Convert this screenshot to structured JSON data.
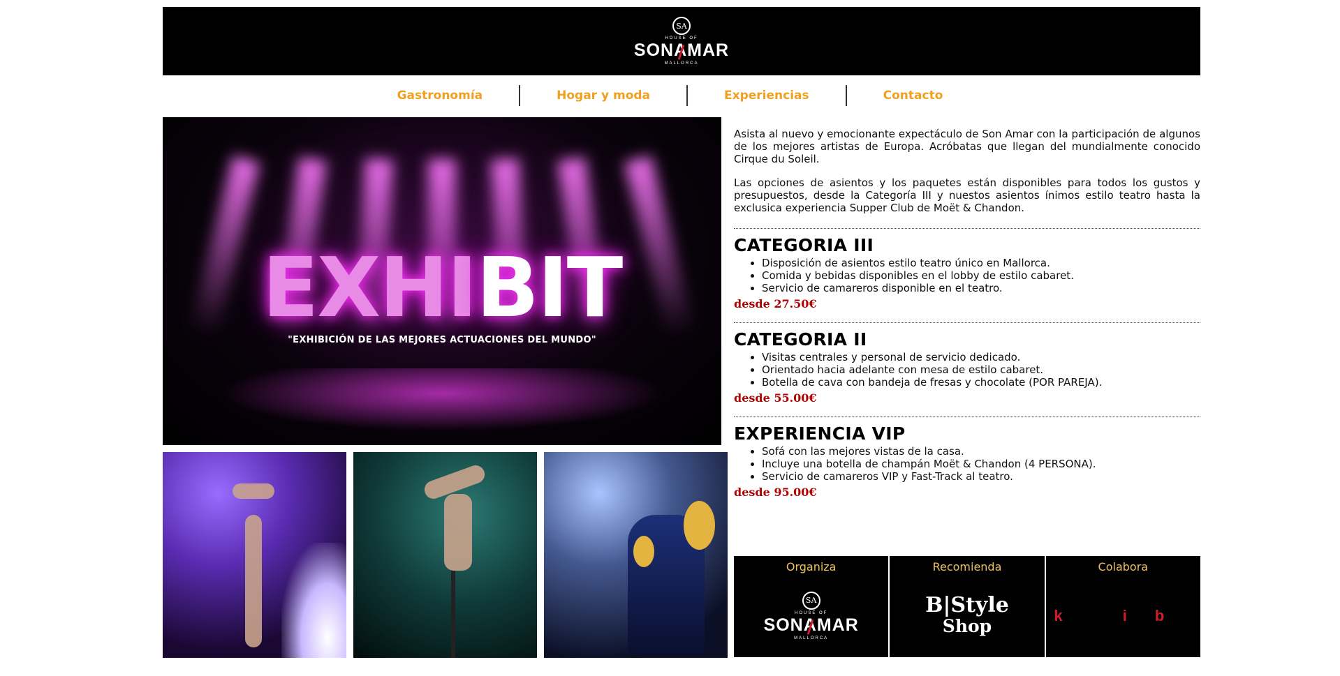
{
  "header": {
    "logo": {
      "crest": "SA",
      "small_top": "HOUSE OF",
      "brand": "SON AMAR",
      "brand_left": "SON",
      "brand_a": "A",
      "brand_right": "MAR",
      "small_bottom": "MALLORCA"
    }
  },
  "nav": {
    "items": [
      "Gastronomía",
      "Hogar y moda",
      "Experiencias",
      "Contacto"
    ],
    "color": "#f0a020"
  },
  "hero": {
    "title_pink": "EXHI",
    "title_white": "BIT",
    "subtitle": "\"EXHIBICIÓN DE LAS MEJORES ACTUACIONES DEL MUNDO\""
  },
  "intro": {
    "p1": "Asista al nuevo y emocionante expectáculo de Son Amar con la participación de algunos de los mejores artistas de Europa. Acróbatas que llegan del mundialmente conocido Cirque du Soleil.",
    "p2": "Las opciones de asientos y los paquetes están disponibles para todos los gustos y presupuestos, desde la Categoría III y nuestos asientos ínimos estilo teatro hasta la exclusica experiencia Supper Club de Moët & Chandon."
  },
  "categories": [
    {
      "title": "CATEGORIA III",
      "items": [
        "Disposición de asientos estilo teatro único en Mallorca.",
        "Comida y bebidas disponibles en el lobby de estilo cabaret.",
        "Servicio de camareros disponible en el teatro."
      ],
      "price": "desde 27.50€"
    },
    {
      "title": "CATEGORIA II",
      "items": [
        "Visitas centrales y personal de servicio dedicado.",
        "Orientado hacia adelante con mesa de estilo cabaret.",
        "Botella de cava con bandeja de fresas y chocolate (POR PAREJA)."
      ],
      "price": "desde 55.00€"
    },
    {
      "title": "EXPERIENCIA VIP",
      "items": [
        "Sofá con las mejores vistas de la casa.",
        "Incluye una botella de champán Moët & Chandon (4 PERSONA).",
        "Servicio de camareros VIP y Fast-Track al teatro."
      ],
      "price": "desde 95.00€"
    }
  ],
  "partners": {
    "organiza": "Organiza",
    "recomienda": "Recomienda",
    "colabora": "Colabora",
    "bstyle_line1": "B|Style",
    "bstyle_line2": "Shop",
    "kib": "k ib"
  },
  "colors": {
    "price": "#b30000",
    "label": "#f0c060",
    "accent_red": "#d21c2c"
  }
}
